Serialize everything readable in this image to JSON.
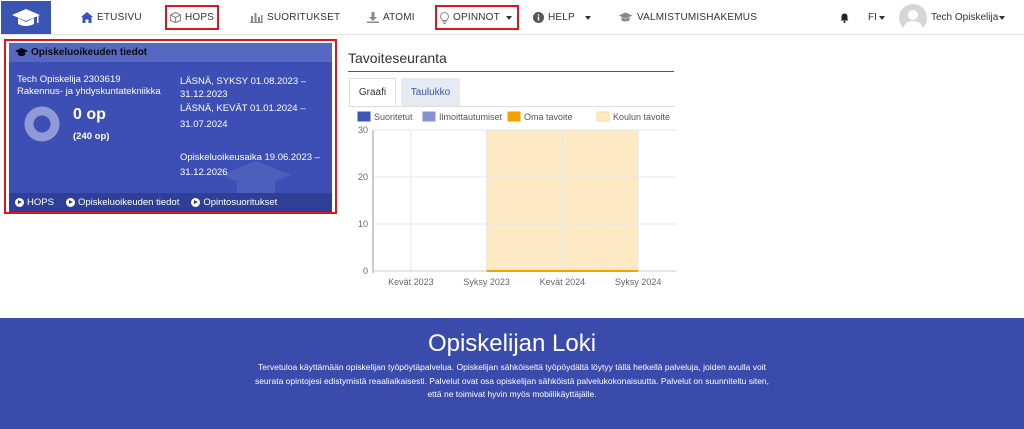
{
  "nav": {
    "items": [
      {
        "label": "ETUSIVU",
        "icon": "home-icon"
      },
      {
        "label": "HOPS",
        "icon": "cube-icon"
      },
      {
        "label": "SUORITUKSET",
        "icon": "bar-chart-icon"
      },
      {
        "label": "ATOMI",
        "icon": "download-icon"
      },
      {
        "label": "OPINNOT",
        "icon": "lightbulb-icon"
      },
      {
        "label": "HELP",
        "icon": "info-icon"
      },
      {
        "label": "VALMISTUMISHAKEMUS",
        "icon": "graduation-cap-icon"
      }
    ],
    "language": "FI",
    "user_name": "Tech Opiskelija"
  },
  "panel": {
    "title": "Opiskeluoikeuden tiedot",
    "student": "Tech Opiskelija 2303619",
    "program": "Rakennus- ja yhdyskuntatekniikka",
    "credits": "0 op",
    "credits_total": "(240 op)",
    "periods": [
      "LÄSNÄ, SYKSY 01.08.2023 –",
      "31.12.2023",
      "LÄSNÄ, KEVÄT 01.01.2024 –",
      "31.07.2024"
    ],
    "right_period": [
      "Opiskeluoikeusaika 19.06.2023 –",
      "31.12.2026"
    ],
    "links": [
      "HOPS",
      "Opiskeluoikeuden tiedot",
      "Opintosuoritukset"
    ]
  },
  "progress": {
    "title": "Tavoiteseuranta",
    "tabs": [
      "Graafi",
      "Taulukko"
    ]
  },
  "chart_data": {
    "type": "bar",
    "categories": [
      "Kevät 2023",
      "Syksy 2023",
      "Kevät 2024",
      "Syksy 2024"
    ],
    "series": [
      {
        "name": "Suoritetut",
        "values": [
          0,
          0,
          0,
          0
        ],
        "color": "#3d56b4"
      },
      {
        "name": "Ilmoittautumiset",
        "values": [
          0,
          0,
          0,
          0
        ],
        "color": "#8592cf"
      },
      {
        "name": "Oma tavoite",
        "values": [
          0,
          0,
          0,
          0
        ],
        "color": "#f2a300"
      },
      {
        "name": "Koulun tavoite",
        "values": [
          0,
          30,
          30,
          30
        ],
        "color": "#fde9c4"
      }
    ],
    "yticks": [
      0,
      10,
      20,
      30
    ],
    "ylim": [
      0,
      30
    ],
    "grid": true,
    "legend": "top"
  },
  "footer": {
    "title": "Opiskelijan Loki",
    "lines": [
      "Tervetuloa käyttämään opiskelijan työpöytäpalvelua. Opiskelijan sähköiseltä työpöydältä löytyy tällä hetkellä palveluja, joiden avulla voit",
      "seurata opintojesi edistymistä reaaliaikaisesti. Palvelut ovat osa opiskelijan sähköistä palvelukokonaisuutta. Palvelut on suunniteltu siten,",
      "että ne toimivat hyvin myös mobiilikäyttäjälle."
    ]
  },
  "colors": {
    "brand": "#3a54b4",
    "highlight": "#e0141b"
  }
}
